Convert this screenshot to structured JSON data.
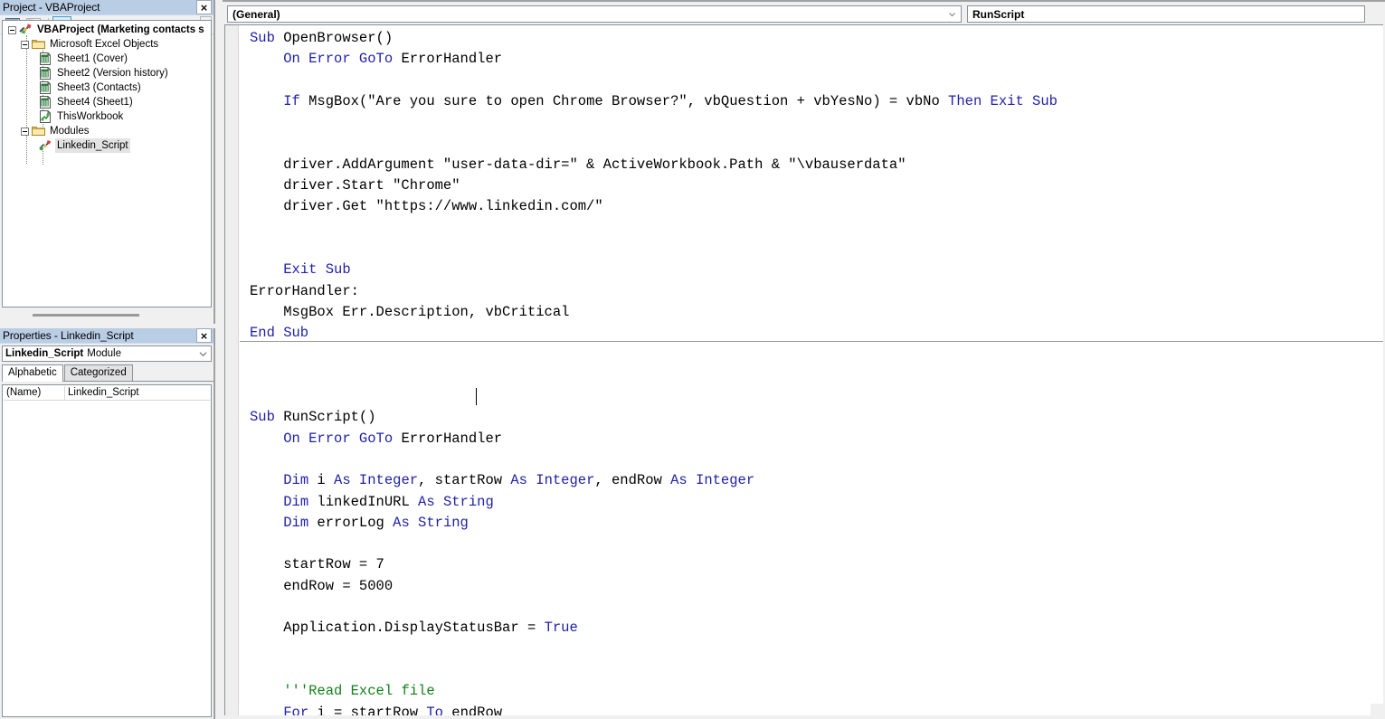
{
  "project_panel": {
    "title": "Project - VBAProject",
    "close_label": "×",
    "toolbar": {
      "view_code_icon": "view-code-icon",
      "view_object_icon": "view-object-icon",
      "toggle_folders_icon": "folder-icon"
    },
    "tree": [
      {
        "label": "VBAProject (Marketing contacts s",
        "indent": 0,
        "icon": "vba-project-icon",
        "bold": true,
        "expander": true,
        "selected": false
      },
      {
        "label": "Microsoft Excel Objects",
        "indent": 1,
        "icon": "folder-icon",
        "bold": false,
        "expander": true,
        "selected": false
      },
      {
        "label": "Sheet1 (Cover)",
        "indent": 2,
        "icon": "worksheet-icon",
        "bold": false,
        "expander": false,
        "selected": false
      },
      {
        "label": "Sheet2 (Version history)",
        "indent": 2,
        "icon": "worksheet-icon",
        "bold": false,
        "expander": false,
        "selected": false
      },
      {
        "label": "Sheet3 (Contacts)",
        "indent": 2,
        "icon": "worksheet-icon",
        "bold": false,
        "expander": false,
        "selected": false
      },
      {
        "label": "Sheet4 (Sheet1)",
        "indent": 2,
        "icon": "worksheet-icon",
        "bold": false,
        "expander": false,
        "selected": false
      },
      {
        "label": "ThisWorkbook",
        "indent": 2,
        "icon": "thisworkbook-icon",
        "bold": false,
        "expander": false,
        "selected": false
      },
      {
        "label": "Modules",
        "indent": 1,
        "icon": "folder-icon",
        "bold": false,
        "expander": true,
        "selected": false
      },
      {
        "label": "Linkedin_Script",
        "indent": 2,
        "icon": "module-icon",
        "bold": false,
        "expander": false,
        "selected": true
      }
    ]
  },
  "properties_panel": {
    "title": "Properties - Linkedin_Script",
    "close_label": "×",
    "object_combo": {
      "name": "Linkedin_Script",
      "type": "Module"
    },
    "tabs": [
      {
        "label": "Alphabetic",
        "active": true
      },
      {
        "label": "Categorized",
        "active": false
      }
    ],
    "rows": [
      {
        "name": "(Name)",
        "value": "Linkedin_Script"
      }
    ]
  },
  "code_window": {
    "object_dropdown_value": "(General)",
    "procedure_dropdown_value": "RunScript",
    "caret_line": 17,
    "colors": {
      "keyword": "#2121a8",
      "comment": "#14801c",
      "text": "#000000",
      "background": "#ffffff",
      "titlebar": "#b9cde5"
    },
    "code_lines": [
      [
        {
          "t": "Sub",
          "c": "kw"
        },
        {
          "t": " OpenBrowser()",
          "c": ""
        }
      ],
      [
        {
          "t": "    ",
          "c": ""
        },
        {
          "t": "On Error GoTo",
          "c": "kw"
        },
        {
          "t": " ErrorHandler",
          "c": ""
        }
      ],
      [
        {
          "t": "",
          "c": ""
        }
      ],
      [
        {
          "t": "    ",
          "c": ""
        },
        {
          "t": "If",
          "c": "kw"
        },
        {
          "t": " MsgBox(\"Are you sure to open Chrome Browser?\", vbQuestion + vbYesNo) = vbNo ",
          "c": ""
        },
        {
          "t": "Then Exit Sub",
          "c": "kw"
        }
      ],
      [
        {
          "t": "",
          "c": ""
        }
      ],
      [
        {
          "t": "",
          "c": ""
        }
      ],
      [
        {
          "t": "    driver.AddArgument \"user-data-dir=\" & ActiveWorkbook.Path & \"\\vbauserdata\"",
          "c": ""
        }
      ],
      [
        {
          "t": "    driver.Start \"Chrome\"",
          "c": ""
        }
      ],
      [
        {
          "t": "    driver.Get \"https://www.linkedin.com/\"",
          "c": ""
        }
      ],
      [
        {
          "t": "",
          "c": ""
        }
      ],
      [
        {
          "t": "",
          "c": ""
        }
      ],
      [
        {
          "t": "    ",
          "c": ""
        },
        {
          "t": "Exit Sub",
          "c": "kw"
        }
      ],
      [
        {
          "t": "ErrorHandler:",
          "c": ""
        }
      ],
      [
        {
          "t": "    MsgBox Err.Description, vbCritical",
          "c": ""
        }
      ],
      [
        {
          "t": "End Sub",
          "c": "kw"
        }
      ],
      [
        {
          "t": "",
          "c": ""
        }
      ],
      [
        {
          "t": "",
          "c": ""
        }
      ],
      [
        {
          "t": "",
          "c": ""
        }
      ],
      [
        {
          "t": "Sub",
          "c": "kw"
        },
        {
          "t": " RunScript()",
          "c": ""
        }
      ],
      [
        {
          "t": "    ",
          "c": ""
        },
        {
          "t": "On Error GoTo",
          "c": "kw"
        },
        {
          "t": " ErrorHandler",
          "c": ""
        }
      ],
      [
        {
          "t": "",
          "c": ""
        }
      ],
      [
        {
          "t": "    ",
          "c": ""
        },
        {
          "t": "Dim",
          "c": "kw"
        },
        {
          "t": " i ",
          "c": ""
        },
        {
          "t": "As Integer",
          "c": "kw"
        },
        {
          "t": ", startRow ",
          "c": ""
        },
        {
          "t": "As Integer",
          "c": "kw"
        },
        {
          "t": ", endRow ",
          "c": ""
        },
        {
          "t": "As Integer",
          "c": "kw"
        }
      ],
      [
        {
          "t": "    ",
          "c": ""
        },
        {
          "t": "Dim",
          "c": "kw"
        },
        {
          "t": " linkedInURL ",
          "c": ""
        },
        {
          "t": "As String",
          "c": "kw"
        }
      ],
      [
        {
          "t": "    ",
          "c": ""
        },
        {
          "t": "Dim",
          "c": "kw"
        },
        {
          "t": " errorLog ",
          "c": ""
        },
        {
          "t": "As String",
          "c": "kw"
        }
      ],
      [
        {
          "t": "",
          "c": ""
        }
      ],
      [
        {
          "t": "    startRow = 7",
          "c": ""
        }
      ],
      [
        {
          "t": "    endRow = 5000",
          "c": ""
        }
      ],
      [
        {
          "t": "",
          "c": ""
        }
      ],
      [
        {
          "t": "    Application.DisplayStatusBar = ",
          "c": ""
        },
        {
          "t": "True",
          "c": "kw"
        }
      ],
      [
        {
          "t": "",
          "c": ""
        }
      ],
      [
        {
          "t": "",
          "c": ""
        }
      ],
      [
        {
          "t": "    ",
          "c": ""
        },
        {
          "t": "'''Read Excel file",
          "c": "cm"
        }
      ],
      [
        {
          "t": "    ",
          "c": ""
        },
        {
          "t": "For",
          "c": "kw"
        },
        {
          "t": " i = startRow ",
          "c": ""
        },
        {
          "t": "To",
          "c": "kw"
        },
        {
          "t": " endRow",
          "c": ""
        }
      ]
    ]
  }
}
